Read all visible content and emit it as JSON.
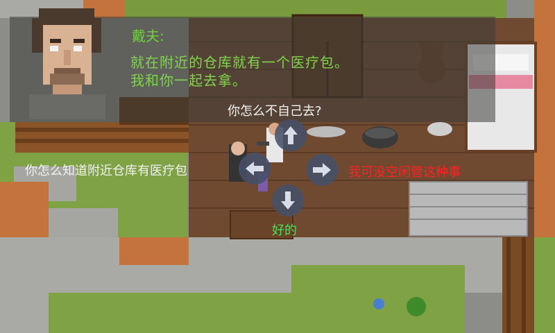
{
  "dialog": {
    "speaker": "戴夫:",
    "line1": "就在附近的仓库就有一个医疗包。",
    "line2": "我和你一起去拿。"
  },
  "choices": {
    "up": "你怎么不自己去?",
    "left": "你怎么知道附近仓库有医疗包",
    "right": "我可没空闲管这种事",
    "down": "好的"
  },
  "colors": {
    "dialog_text": "#7fd64a",
    "choice_neutral": "#f2f2f2",
    "choice_refuse": "#ff2222",
    "choice_accept": "#49e35a",
    "arrow_button": "#465069"
  },
  "icons": {
    "up": "arrow-up-icon",
    "left": "arrow-left-icon",
    "right": "arrow-right-icon",
    "down": "arrow-down-icon"
  }
}
